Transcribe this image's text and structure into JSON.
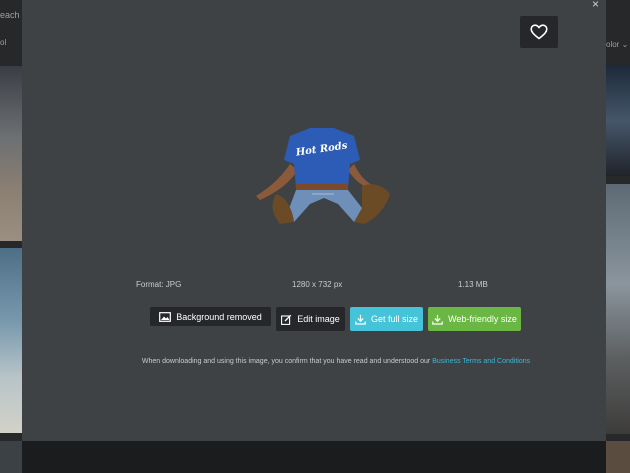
{
  "background": {
    "search_text": "each",
    "filter_text": "ol",
    "color_text": "olor"
  },
  "modal": {
    "format": "Format: JPG",
    "dimensions": "1280 x 732 px",
    "file_size": "1.13 MB",
    "buttons": {
      "background_removed": "Background removed",
      "edit_image": "Edit image",
      "get_full_size": "Get full size",
      "web_friendly": "Web-friendly size"
    },
    "terms_prefix": "When downloading and using this image, you confirm that you have read and understood our ",
    "terms_link": "Business Terms and Conditions",
    "shirt_text": "Hot Rods"
  },
  "icons": {
    "favorite": "heart-icon",
    "close": "close-icon",
    "background_removed": "image-icon",
    "edit": "edit-icon",
    "download": "download-icon",
    "chevron": "chevron-down-icon"
  },
  "colors": {
    "modal_bg": "#3e4245",
    "dark_button": "#25272a",
    "full_size_button": "#44c3d9",
    "web_friendly_button": "#6bb744",
    "link": "#3fb7d6"
  }
}
